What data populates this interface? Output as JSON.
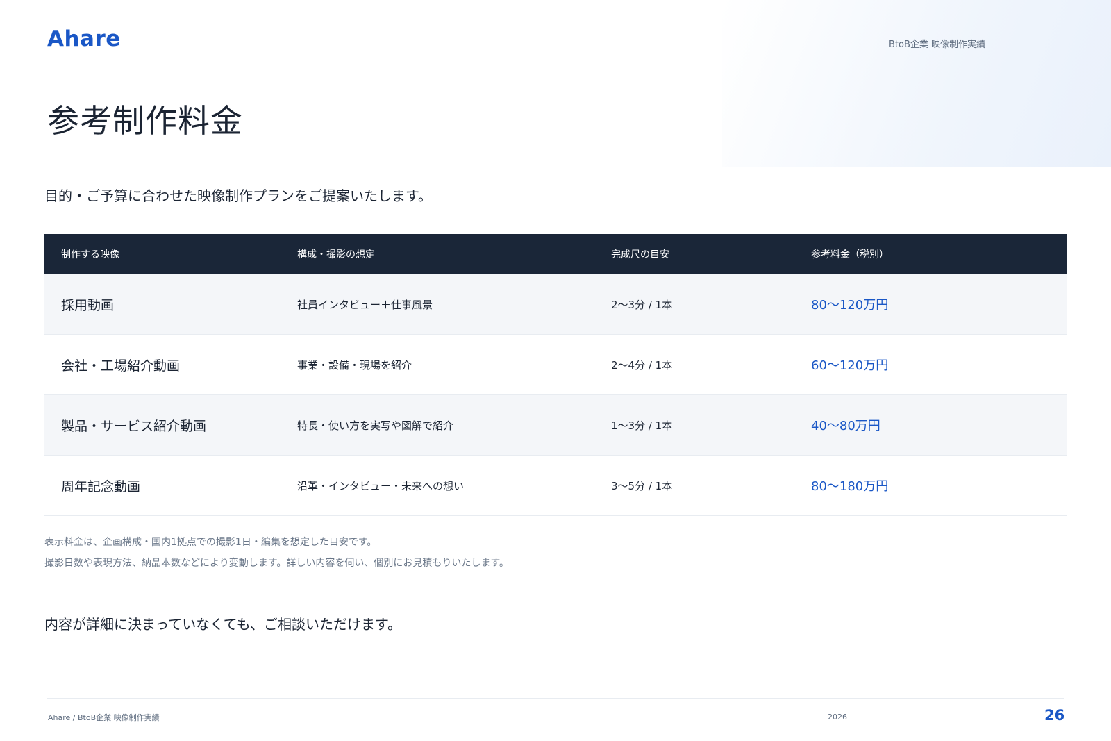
{
  "brand": {
    "logo_text": "Ahare",
    "header_tag": "BtoB企業 映像制作実績"
  },
  "page": {
    "title": "参考制作料金",
    "lead": "目的・ご予算に合わせた映像制作プランをご提案いたします。"
  },
  "table": {
    "headers": [
      "制作する映像",
      "構成・撮影の想定",
      "完成尺の目安",
      "参考料金（税別）"
    ],
    "rows": [
      {
        "video": "採用動画",
        "plan": "社員インタビュー＋仕事風景",
        "length": "2〜3分 / 1本",
        "price": "80〜120万円"
      },
      {
        "video": "会社・工場紹介動画",
        "plan": "事業・設備・現場を紹介",
        "length": "2〜4分 / 1本",
        "price": "60〜120万円"
      },
      {
        "video": "製品・サービス紹介動画",
        "plan": "特長・使い方を実写や図解で紹介",
        "length": "1〜3分 / 1本",
        "price": "40〜80万円"
      },
      {
        "video": "周年記念動画",
        "plan": "沿革・インタビュー・未来への想い",
        "length": "3〜5分 / 1本",
        "price": "80〜180万円"
      }
    ]
  },
  "notes": [
    "表示料金は、企画構成・国内1拠点での撮影1日・編集を想定した目安です。",
    "撮影日数や表現方法、納品本数などにより変動します。詳しい内容を伺い、個別にお見積もりいたします。"
  ],
  "closing": "内容が詳細に決まっていなくても、ご相談いただけます。",
  "footer": {
    "breadcrumb": "Ahare / BtoB企業 映像制作実績",
    "year": "2026",
    "page_number": "26"
  },
  "colors": {
    "accent": "#1a57c6",
    "header_bg": "#1a2638",
    "row_alt": "#f4f6f9"
  }
}
